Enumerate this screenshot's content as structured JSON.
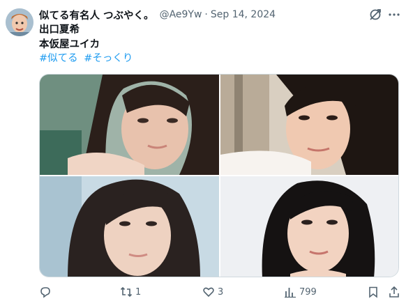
{
  "tweet": {
    "author": {
      "display_name": "似てる有名人 つぶやく。",
      "handle": "@Ae9Yw",
      "separator": "·",
      "date": "Sep 14, 2024"
    },
    "lines": [
      "出口夏希",
      "本仮屋ユイカ"
    ],
    "hashtags": [
      "#似てる",
      "#そっくり"
    ],
    "media": {
      "photos": [
        {
          "id": 1,
          "tones": {
            "bg": "#8fa69a",
            "skin": "#e8c2ad",
            "hair": "#2b1f1a"
          }
        },
        {
          "id": 2,
          "tones": {
            "bg": "#cbbfae",
            "skin": "#f0c9b1",
            "hair": "#1e1612"
          }
        },
        {
          "id": 3,
          "tones": {
            "bg": "#bfd3de",
            "skin": "#eed2c1",
            "hair": "#2a2220"
          }
        },
        {
          "id": 4,
          "tones": {
            "bg": "#eef0f3",
            "skin": "#f2d3c1",
            "hair": "#151212"
          }
        }
      ]
    },
    "actions": {
      "reply_count": "",
      "retweet_count": "1",
      "like_count": "3",
      "view_count": "799"
    }
  },
  "icons": {
    "grok": "grok-icon",
    "more": "more-icon",
    "reply": "reply-icon",
    "retweet": "retweet-icon",
    "like": "heart-icon",
    "views": "views-icon",
    "bookmark": "bookmark-icon",
    "share": "share-icon"
  },
  "colors": {
    "accent": "#1d9bf0",
    "text": "#0f1419",
    "secondary": "#536471",
    "border": "#cfd9de"
  }
}
